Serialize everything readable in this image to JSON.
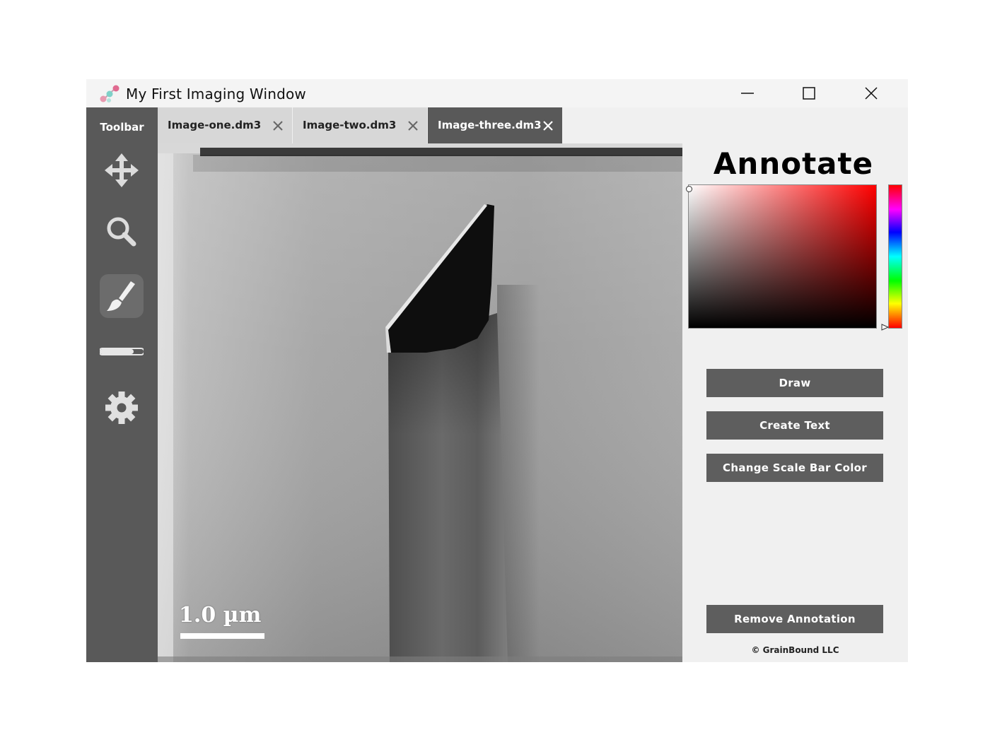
{
  "window": {
    "title": "My First Imaging Window",
    "controls": {
      "minimize": "minimize-icon",
      "maximize": "maximize-icon",
      "close": "close-icon"
    }
  },
  "sidebar": {
    "title": "Toolbar",
    "tools": [
      {
        "name": "move",
        "icon": "move-arrows-icon",
        "active": false
      },
      {
        "name": "zoom",
        "icon": "magnifier-icon",
        "active": false
      },
      {
        "name": "annotate",
        "icon": "brush-icon",
        "active": true
      },
      {
        "name": "scale-bar",
        "icon": "scale-bar-icon",
        "active": false
      },
      {
        "name": "settings",
        "icon": "gear-icon",
        "active": false
      }
    ]
  },
  "tabs": [
    {
      "label": "Image-one.dm3",
      "active": false
    },
    {
      "label": "Image-two.dm3",
      "active": false
    },
    {
      "label": "Image-three.dm3",
      "active": true
    }
  ],
  "viewer": {
    "scale_label": "1.0 µm"
  },
  "panel": {
    "title": "Annotate",
    "color_picker": {
      "hue": "#ff0000",
      "selected": "#ffffff"
    },
    "buttons": {
      "draw": "Draw",
      "create_text": "Create Text",
      "change_scale_bar_color": "Change Scale Bar Color",
      "remove_annotation": "Remove Annotation"
    },
    "copyright": "© GrainBound LLC"
  },
  "colors": {
    "sidebar": "#595959",
    "button": "#5e5e5e",
    "tab_inactive": "#d7d7d7",
    "panel": "#f0f0f0"
  }
}
